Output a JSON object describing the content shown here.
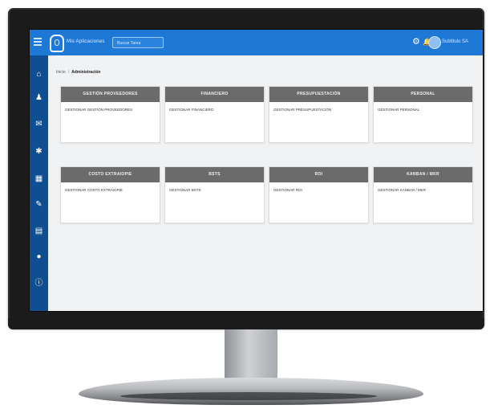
{
  "topbar": {
    "app_title": "Mis Aplicaciones",
    "search_placeholder": "Buscar Tarea",
    "user_name": "Subtitulo SA",
    "icons": [
      "menu-icon",
      "logo-icon",
      "settings-icon",
      "bell-icon",
      "avatar"
    ]
  },
  "breadcrumb": {
    "home": "Inicio",
    "current": "Administración"
  },
  "sidebar": {
    "icons": [
      "home-icon",
      "people-icon",
      "megaphone-icon",
      "bug-icon",
      "calendar-icon",
      "wrench-icon",
      "document-icon",
      "location-icon",
      "info-icon"
    ]
  },
  "cards": [
    {
      "title": "GESTIÓN PROVEEDORES",
      "desc": "GESTIONAR GESTIÓN PROVEEDORES"
    },
    {
      "title": "FINANCIERO",
      "desc": "GESTIONAR FINANCIERO"
    },
    {
      "title": "PRESUPUESTACIÓN",
      "desc": "GESTIONAR PRESUPUESTACIÓN"
    },
    {
      "title": "PERSONAL",
      "desc": "GESTIONAR PERSONAL"
    },
    {
      "title": "COSTO EXTRAIOPIE",
      "desc": "GESTIONAR COSTO EXTRAIOPIE"
    },
    {
      "title": "BSTS",
      "desc": "GESTIONAR BSTS"
    },
    {
      "title": "ROI",
      "desc": "GESTIONAR ROI"
    },
    {
      "title": "KANBAN / MKR",
      "desc": "GESTIONAR KANBAN / MKR"
    }
  ],
  "colors": {
    "topbar": "#1e78d6",
    "sidebar": "#0f4f91",
    "card_header": "#6b6b6b",
    "screen_bg": "#f1f2f4"
  }
}
